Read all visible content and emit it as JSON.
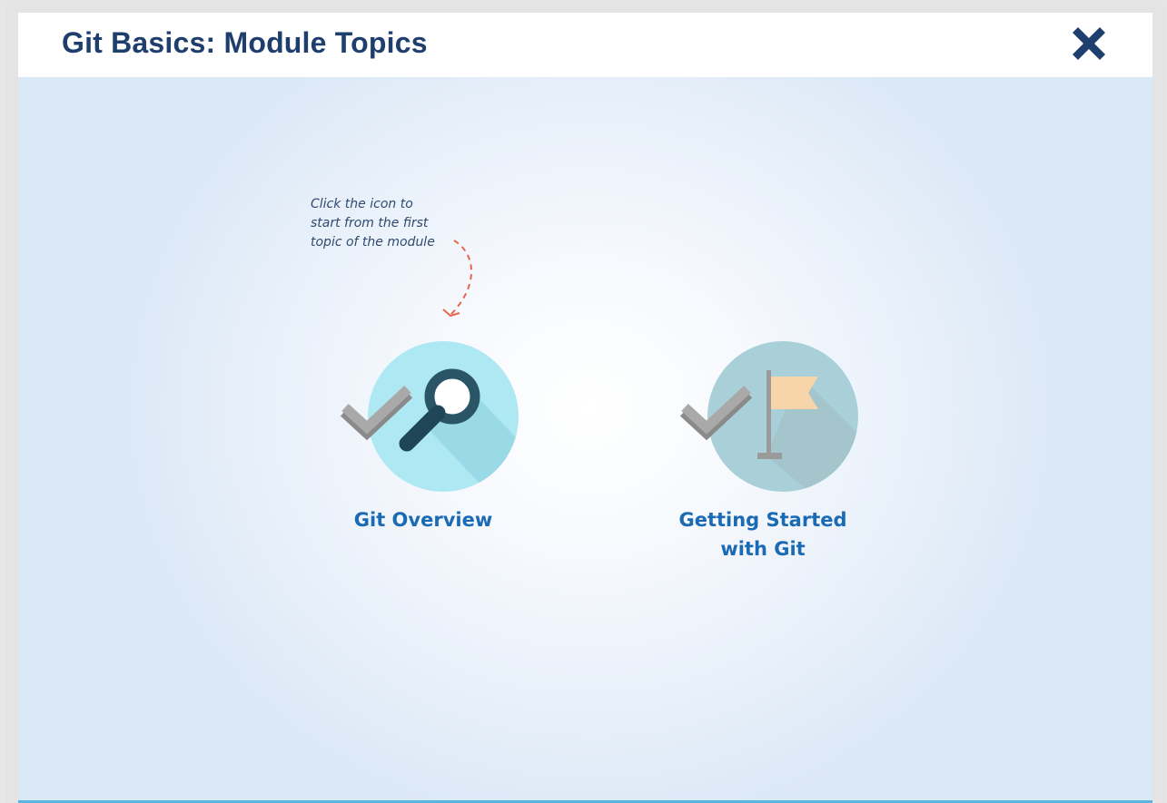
{
  "header": {
    "title": "Git Basics: Module Topics",
    "close_icon": "close-icon"
  },
  "hint": {
    "lines": [
      "Click the icon to",
      "start from the first",
      "topic of the module"
    ],
    "arrow_color": "#e8664f"
  },
  "topics": [
    {
      "label_lines": [
        "Git Overview"
      ],
      "icon": "magnifier-icon",
      "status_icon": "checkmark-icon",
      "circle_color": "#aee8f3"
    },
    {
      "label_lines": [
        "Getting Started",
        "with Git"
      ],
      "icon": "flag-icon",
      "status_icon": "checkmark-icon",
      "circle_color": "#a9d0d8"
    }
  ],
  "colors": {
    "title": "#1e3f6e",
    "topic_label": "#1a6ab4",
    "bottom_bar": "#5ab4e0"
  }
}
